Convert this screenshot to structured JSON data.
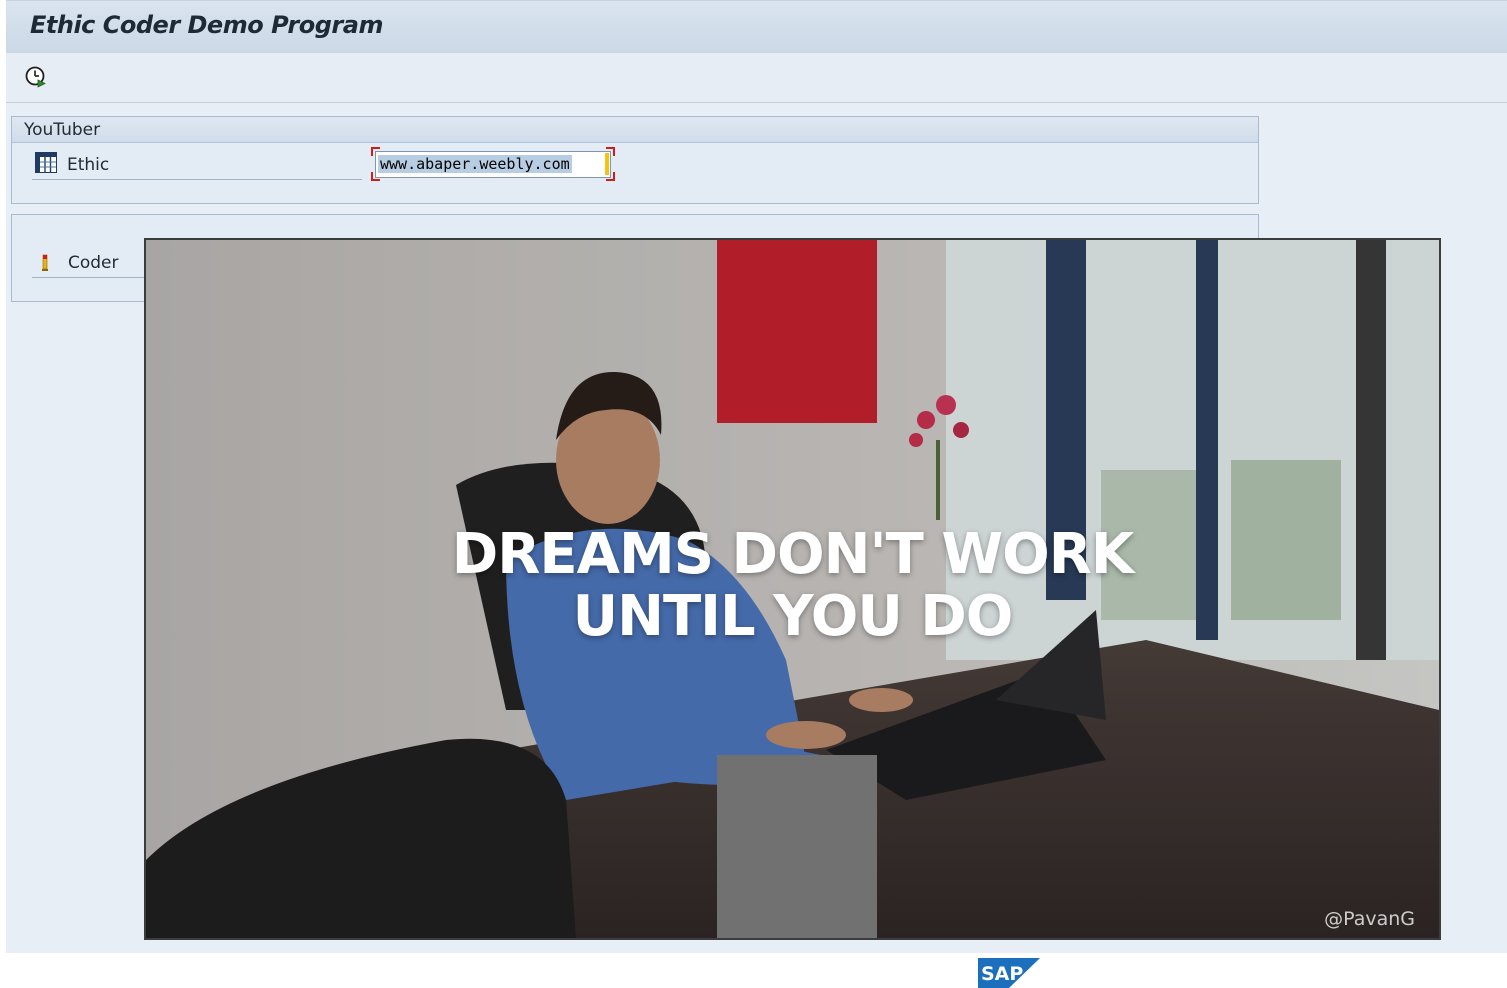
{
  "window": {
    "title": "Ethic Coder Demo Program"
  },
  "toolbar": {
    "execute_icon": "execute-clock-icon"
  },
  "frame_youtuber": {
    "title": "YouTuber",
    "field_label": "Ethic",
    "field_icon": "table-matrix-icon",
    "field_value": "www.abaper.weebly.com"
  },
  "frame_coder": {
    "field_label": "Coder",
    "field_icon": "required-entry-icon"
  },
  "image_overlay": {
    "quote_line1": "DREAMS DON'T WORK",
    "quote_line2": "UNTIL YOU DO",
    "watermark": "@PavanG",
    "block_top_color": "#c0212e",
    "block_bottom_color": "#7b7b7b"
  },
  "footer": {
    "logo_text": "SAP",
    "logo_color": "#1c6fbd"
  }
}
